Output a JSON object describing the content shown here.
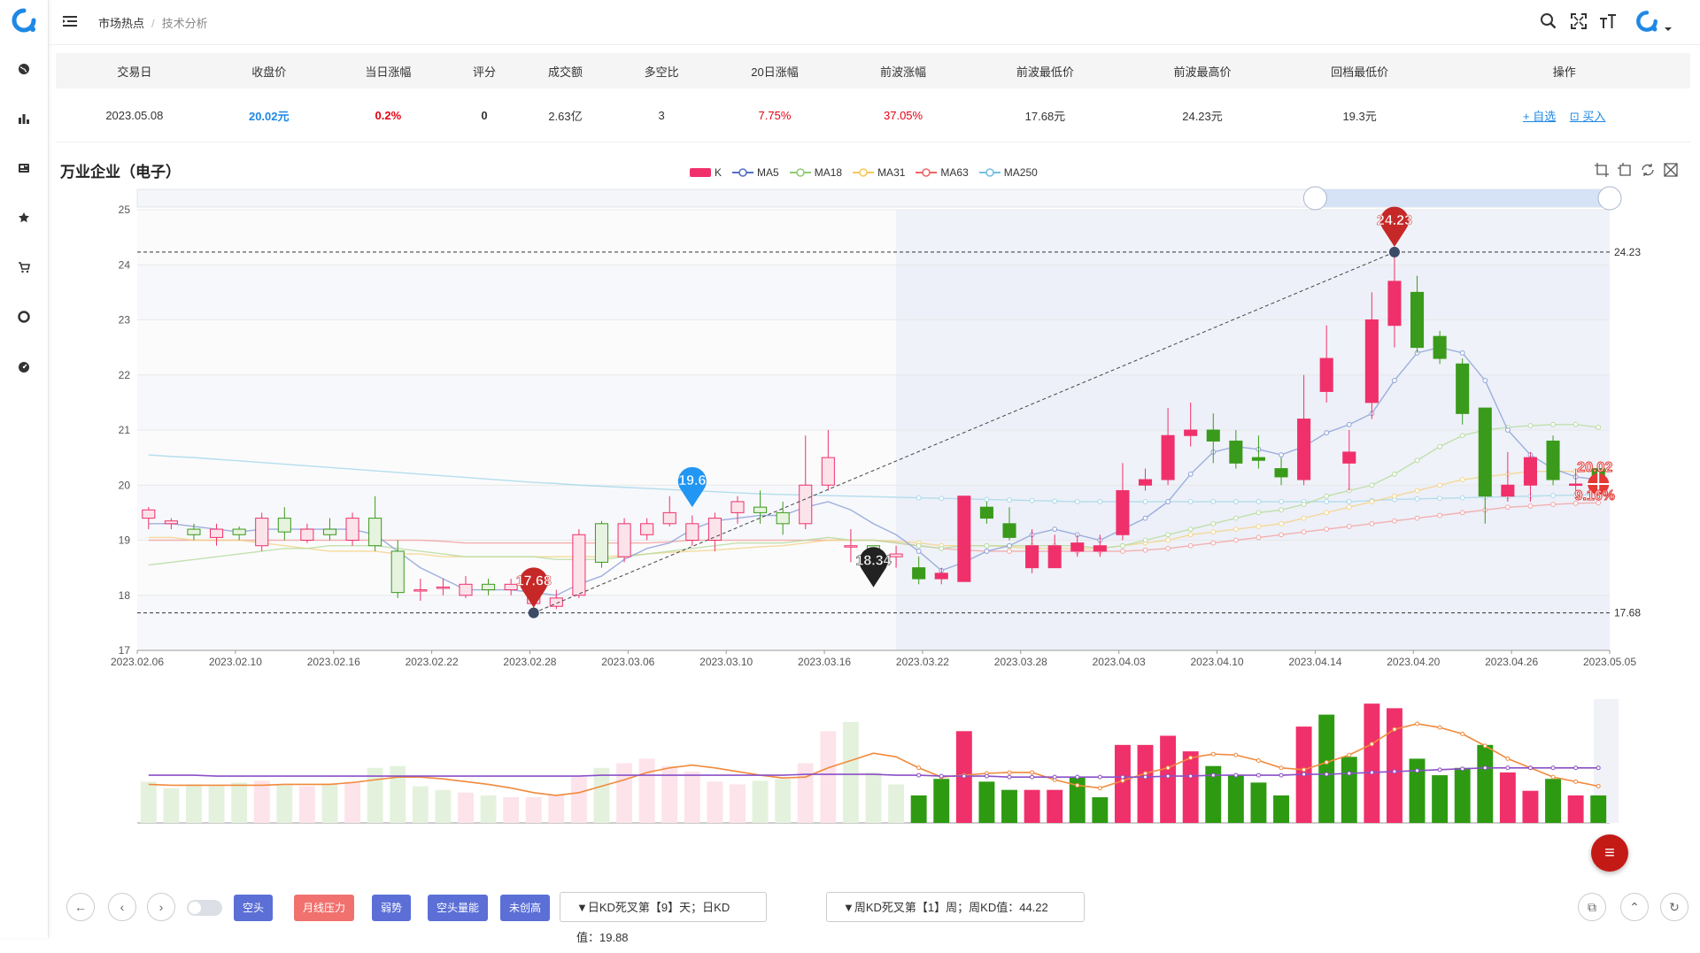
{
  "breadcrumb": {
    "root": "市场热点",
    "current": "技术分析"
  },
  "summary": {
    "headers": [
      "交易日",
      "收盘价",
      "当日涨幅",
      "评分",
      "成交额",
      "多空比",
      "20日涨幅",
      "前波涨幅",
      "前波最低价",
      "前波最高价",
      "回档最低价",
      "操作"
    ],
    "row": {
      "date": "2023.05.08",
      "close": "20.02元",
      "change": "0.2%",
      "score": "0",
      "turnover": "2.63亿",
      "ratio": "3",
      "change20": "7.75%",
      "prev_wave": "37.05%",
      "prev_low": "17.68元",
      "prev_high": "24.23元",
      "pullback_low": "19.3元"
    },
    "ops": {
      "watch": "+ 自选",
      "buy": "买入"
    }
  },
  "chart_title": "万业企业（电子）",
  "legend": [
    {
      "name": "K",
      "color": "#f0306a"
    },
    {
      "name": "MA5",
      "color": "#5470c6"
    },
    {
      "name": "MA18",
      "color": "#91cc75"
    },
    {
      "name": "MA31",
      "color": "#fac858"
    },
    {
      "name": "MA63",
      "color": "#ee6666"
    },
    {
      "name": "MA250",
      "color": "#73c0de"
    }
  ],
  "bottom": {
    "tags": [
      {
        "label": "空头",
        "color": "#5b6fd6"
      },
      {
        "label": "月线压力",
        "color": "#f0716e"
      },
      {
        "label": "弱势",
        "color": "#5b6fd6"
      },
      {
        "label": "空头量能",
        "color": "#5b6fd6"
      },
      {
        "label": "未创高",
        "color": "#5b6fd6"
      }
    ],
    "kd_day": "▼日KD死叉第【9】天；日KD值：19.88",
    "kd_week": "▼周KD死叉第【1】周；周KD值：44.22"
  },
  "colors": {
    "up": "#f0306a",
    "down": "#3a9a1b",
    "accent": "#1e88e5"
  },
  "chart_data": {
    "type": "candlestick",
    "ylim": [
      17,
      25
    ],
    "yticks": [
      "25",
      "24",
      "23",
      "22",
      "21",
      "20",
      "19",
      "18",
      "17"
    ],
    "xticks": [
      "2023.02.06",
      "2023.02.10",
      "2023.02.16",
      "2023.02.22",
      "2023.02.28",
      "2023.03.06",
      "2023.03.10",
      "2023.03.16",
      "2023.03.22",
      "2023.03.28",
      "2023.04.03",
      "2023.04.10",
      "2023.04.14",
      "2023.04.20",
      "2023.04.26",
      "2023.05.05"
    ],
    "candles": [
      [
        19.4,
        19.55,
        19.2,
        19.6
      ],
      [
        19.3,
        19.35,
        19.2,
        19.4
      ],
      [
        19.2,
        19.1,
        19.0,
        19.3
      ],
      [
        19.05,
        19.2,
        18.9,
        19.3
      ],
      [
        19.2,
        19.1,
        19.0,
        19.25
      ],
      [
        18.9,
        19.4,
        18.8,
        19.5
      ],
      [
        19.4,
        19.15,
        19.0,
        19.6
      ],
      [
        19.0,
        19.2,
        18.95,
        19.3
      ],
      [
        19.2,
        19.1,
        19.0,
        19.4
      ],
      [
        19.0,
        19.4,
        18.9,
        19.5
      ],
      [
        19.4,
        18.9,
        18.8,
        19.8
      ],
      [
        18.8,
        18.05,
        17.95,
        19.0
      ],
      [
        18.1,
        18.1,
        17.9,
        18.3
      ],
      [
        18.15,
        18.15,
        18.0,
        18.3
      ],
      [
        18.0,
        18.2,
        17.95,
        18.35
      ],
      [
        18.2,
        18.1,
        18.0,
        18.3
      ],
      [
        18.1,
        18.2,
        18.0,
        18.3
      ],
      [
        17.85,
        18.05,
        17.7,
        18.3
      ],
      [
        17.8,
        17.95,
        17.75,
        18.1
      ],
      [
        18.0,
        19.1,
        17.95,
        19.2
      ],
      [
        19.3,
        18.6,
        18.5,
        19.35
      ],
      [
        18.7,
        19.3,
        18.6,
        19.4
      ],
      [
        19.1,
        19.3,
        19.0,
        19.4
      ],
      [
        19.3,
        19.5,
        19.25,
        19.8
      ],
      [
        19.0,
        19.3,
        18.9,
        19.45
      ],
      [
        19.0,
        19.4,
        18.8,
        19.5
      ],
      [
        19.5,
        19.7,
        19.3,
        19.8
      ],
      [
        19.6,
        19.5,
        19.3,
        19.9
      ],
      [
        19.5,
        19.3,
        19.1,
        19.7
      ],
      [
        19.3,
        20.0,
        19.2,
        20.9
      ],
      [
        20.0,
        20.5,
        19.9,
        21.0
      ],
      [
        18.9,
        18.9,
        18.6,
        19.2
      ],
      [
        18.9,
        18.7,
        18.3,
        18.9
      ],
      [
        18.7,
        18.75,
        18.5,
        18.9
      ],
      [
        18.5,
        18.3,
        18.2,
        18.7
      ],
      [
        18.3,
        18.4,
        18.2,
        18.5
      ],
      [
        18.25,
        19.8,
        18.25,
        19.8
      ],
      [
        19.6,
        19.4,
        19.3,
        19.7
      ],
      [
        19.3,
        19.05,
        19.0,
        19.6
      ],
      [
        18.5,
        18.9,
        18.4,
        19.2
      ],
      [
        18.5,
        18.9,
        18.5,
        19.1
      ],
      [
        18.8,
        18.95,
        18.7,
        19.1
      ],
      [
        18.8,
        18.9,
        18.7,
        19.1
      ],
      [
        19.1,
        19.9,
        19.0,
        20.4
      ],
      [
        20.0,
        20.1,
        19.9,
        20.3
      ],
      [
        20.1,
        20.9,
        20.0,
        21.4
      ],
      [
        20.9,
        21.0,
        20.7,
        21.5
      ],
      [
        21.0,
        20.8,
        20.4,
        21.3
      ],
      [
        20.8,
        20.4,
        20.3,
        21.0
      ],
      [
        20.5,
        20.45,
        20.3,
        20.9
      ],
      [
        20.3,
        20.15,
        20.0,
        20.5
      ],
      [
        20.1,
        21.2,
        20.0,
        22.0
      ],
      [
        21.7,
        22.3,
        21.5,
        22.9
      ],
      [
        20.4,
        20.6,
        19.9,
        21.0
      ],
      [
        21.5,
        23.0,
        21.2,
        23.5
      ],
      [
        22.9,
        23.7,
        22.5,
        24.23
      ],
      [
        23.5,
        22.5,
        22.4,
        23.8
      ],
      [
        22.7,
        22.3,
        22.2,
        22.8
      ],
      [
        22.2,
        21.3,
        21.1,
        22.3
      ],
      [
        21.4,
        19.8,
        19.3,
        21.4
      ],
      [
        19.8,
        20.0,
        19.7,
        20.6
      ],
      [
        20.0,
        20.5,
        19.7,
        20.6
      ],
      [
        20.8,
        20.1,
        20.0,
        20.9
      ],
      [
        20.0,
        20.02,
        19.9,
        20.3
      ],
      [
        20.3,
        19.95,
        19.8,
        20.4
      ]
    ],
    "ma5": [
      19.3,
      19.3,
      19.25,
      19.2,
      19.15,
      19.2,
      19.2,
      19.2,
      19.2,
      19.2,
      19.1,
      18.8,
      18.5,
      18.3,
      18.1,
      18.1,
      18.1,
      18.05,
      18.0,
      18.2,
      18.35,
      18.65,
      18.85,
      18.95,
      19.2,
      19.35,
      19.4,
      19.45,
      19.45,
      19.6,
      19.7,
      19.55,
      19.3,
      19.1,
      18.8,
      18.45,
      18.6,
      18.8,
      18.9,
      19.1,
      19.2,
      19.1,
      19.0,
      19.2,
      19.4,
      19.7,
      20.2,
      20.6,
      20.7,
      20.65,
      20.55,
      20.7,
      20.95,
      21.1,
      21.3,
      21.9,
      22.4,
      22.5,
      22.4,
      21.9,
      21.0,
      20.55,
      20.3,
      20.15,
      20.1
    ],
    "ma18": [
      18.55,
      18.6,
      18.65,
      18.7,
      18.75,
      18.8,
      18.85,
      18.85,
      18.9,
      18.9,
      18.9,
      18.85,
      18.8,
      18.75,
      18.7,
      18.7,
      18.7,
      18.7,
      18.65,
      18.65,
      18.65,
      18.7,
      18.75,
      18.8,
      18.85,
      18.9,
      18.95,
      18.95,
      18.95,
      19.0,
      19.05,
      19.0,
      19.0,
      18.95,
      18.9,
      18.85,
      18.9,
      18.9,
      18.9,
      18.9,
      18.9,
      18.9,
      18.85,
      18.9,
      19.0,
      19.1,
      19.2,
      19.3,
      19.4,
      19.5,
      19.55,
      19.65,
      19.8,
      19.9,
      20.0,
      20.2,
      20.45,
      20.7,
      20.9,
      21.0,
      21.05,
      21.08,
      21.1,
      21.1,
      21.05
    ],
    "ma31": [
      19.05,
      19.05,
      19.0,
      19.0,
      19.0,
      18.95,
      18.9,
      18.85,
      18.8,
      18.8,
      18.8,
      18.75,
      18.75,
      18.7,
      18.7,
      18.7,
      18.7,
      18.7,
      18.7,
      18.7,
      18.7,
      18.72,
      18.75,
      18.78,
      18.8,
      18.82,
      18.85,
      18.88,
      18.9,
      18.95,
      19.0,
      19.0,
      19.0,
      18.98,
      18.95,
      18.9,
      18.9,
      18.9,
      18.88,
      18.85,
      18.85,
      18.85,
      18.85,
      18.9,
      18.95,
      19.0,
      19.1,
      19.15,
      19.2,
      19.25,
      19.3,
      19.4,
      19.5,
      19.6,
      19.7,
      19.8,
      19.9,
      20.0,
      20.1,
      20.15,
      20.2,
      20.25,
      20.25,
      20.25,
      20.25
    ],
    "ma63": [
      19.0,
      19.0,
      19.0,
      19.0,
      19.0,
      19.0,
      19.0,
      19.0,
      19.0,
      19.0,
      19.0,
      19.0,
      19.0,
      18.98,
      18.95,
      18.95,
      18.95,
      18.95,
      18.95,
      18.95,
      18.95,
      18.95,
      18.95,
      18.97,
      19.0,
      19.0,
      19.0,
      19.0,
      19.0,
      19.0,
      19.0,
      19.0,
      19.0,
      18.95,
      18.9,
      18.85,
      18.82,
      18.8,
      18.8,
      18.8,
      18.8,
      18.8,
      18.8,
      18.8,
      18.82,
      18.85,
      18.9,
      18.95,
      19.0,
      19.05,
      19.1,
      19.15,
      19.2,
      19.25,
      19.3,
      19.35,
      19.4,
      19.45,
      19.5,
      19.55,
      19.6,
      19.62,
      19.65,
      19.67,
      19.68
    ],
    "ma250": [
      20.55,
      20.52,
      20.5,
      20.47,
      20.44,
      20.41,
      20.38,
      20.35,
      20.32,
      20.29,
      20.26,
      20.23,
      20.2,
      20.17,
      20.14,
      20.11,
      20.08,
      20.05,
      20.03,
      20.0,
      19.98,
      19.96,
      19.94,
      19.92,
      19.9,
      19.88,
      19.86,
      19.84,
      19.83,
      19.82,
      19.81,
      19.8,
      19.79,
      19.78,
      19.77,
      19.76,
      19.75,
      19.74,
      19.73,
      19.72,
      19.71,
      19.7,
      19.7,
      19.7,
      19.7,
      19.7,
      19.7,
      19.7,
      19.7,
      19.7,
      19.7,
      19.7,
      19.7,
      19.7,
      19.72,
      19.74,
      19.75,
      19.76,
      19.77,
      19.78,
      19.79,
      19.8,
      19.81,
      19.82,
      19.83
    ],
    "volumes": [
      0.45,
      0.38,
      0.42,
      0.4,
      0.44,
      0.46,
      0.41,
      0.4,
      0.43,
      0.45,
      0.6,
      0.62,
      0.4,
      0.36,
      0.33,
      0.3,
      0.28,
      0.28,
      0.31,
      0.5,
      0.6,
      0.65,
      0.7,
      0.62,
      0.56,
      0.45,
      0.42,
      0.46,
      0.48,
      0.65,
      1.0,
      1.1,
      0.93,
      0.7,
      0.58,
      0.5,
      0.58,
      0.66,
      0.64,
      0.56,
      0.46,
      0.44,
      0.46,
      0.51,
      0.6,
      0.64,
      0.66,
      0.62,
      0.65,
      0.6,
      0.55,
      0.5,
      0.58,
      0.61,
      0.63,
      0.66,
      0.63,
      0.62,
      0.6,
      0.58,
      0.54,
      0.5,
      0.46,
      0.43,
      0.4
    ],
    "vol_colors": [
      "d",
      "d",
      "d",
      "d",
      "d",
      "u",
      "d",
      "u",
      "d",
      "u",
      "d",
      "d",
      "d",
      "d",
      "u",
      "d",
      "u",
      "u",
      "u",
      "u",
      "d",
      "u",
      "u",
      "u",
      "u",
      "u",
      "u",
      "d",
      "d",
      "u",
      "u",
      "d",
      "d",
      "d",
      "d",
      "d",
      "u",
      "d",
      "d",
      "u",
      "u",
      "d",
      "d",
      "u",
      "u",
      "u",
      "u",
      "d",
      "d",
      "d",
      "d",
      "u",
      "d",
      "d",
      "u",
      "u",
      "d",
      "d",
      "d",
      "d",
      "u",
      "u",
      "d",
      "u",
      "d"
    ],
    "vol_values": [
      0.45,
      0.38,
      0.42,
      0.4,
      0.44,
      0.46,
      0.41,
      0.4,
      0.43,
      0.45,
      0.6,
      0.62,
      0.4,
      0.36,
      0.33,
      0.3,
      0.28,
      0.28,
      0.31,
      0.5,
      0.6,
      0.65,
      0.7,
      0.62,
      0.56,
      0.45,
      0.42,
      0.46,
      0.48,
      0.65,
      1.0,
      1.1,
      0.55,
      0.42,
      0.3,
      0.48,
      1.0,
      0.45,
      0.36,
      0.36,
      0.36,
      0.5,
      0.28,
      0.85,
      0.85,
      0.95,
      0.78,
      0.62,
      0.52,
      0.44,
      0.3,
      1.05,
      1.18,
      0.72,
      1.3,
      1.25,
      0.7,
      0.52,
      0.6,
      0.85,
      0.55,
      0.35,
      0.48,
      0.3,
      0.3
    ],
    "vol_ma": [
      0.42,
      0.41,
      0.41,
      0.41,
      0.41,
      0.41,
      0.42,
      0.42,
      0.42,
      0.44,
      0.47,
      0.5,
      0.5,
      0.48,
      0.45,
      0.42,
      0.38,
      0.33,
      0.3,
      0.33,
      0.4,
      0.47,
      0.55,
      0.6,
      0.63,
      0.6,
      0.56,
      0.52,
      0.49,
      0.5,
      0.6,
      0.68,
      0.76,
      0.72,
      0.6,
      0.5,
      0.52,
      0.54,
      0.55,
      0.55,
      0.47,
      0.41,
      0.38,
      0.46,
      0.54,
      0.6,
      0.71,
      0.75,
      0.74,
      0.68,
      0.6,
      0.58,
      0.66,
      0.74,
      0.86,
      1.02,
      1.08,
      1.04,
      0.97,
      0.84,
      0.7,
      0.6,
      0.5,
      0.45,
      0.4
    ],
    "vol_ma2": [
      0.52,
      0.52,
      0.52,
      0.51,
      0.51,
      0.51,
      0.51,
      0.51,
      0.51,
      0.51,
      0.51,
      0.51,
      0.51,
      0.51,
      0.51,
      0.51,
      0.51,
      0.51,
      0.51,
      0.51,
      0.52,
      0.52,
      0.52,
      0.52,
      0.52,
      0.52,
      0.52,
      0.52,
      0.52,
      0.53,
      0.53,
      0.53,
      0.53,
      0.52,
      0.52,
      0.51,
      0.51,
      0.51,
      0.5,
      0.5,
      0.5,
      0.5,
      0.5,
      0.5,
      0.5,
      0.51,
      0.51,
      0.52,
      0.52,
      0.52,
      0.52,
      0.53,
      0.53,
      0.54,
      0.55,
      0.56,
      0.57,
      0.58,
      0.59,
      0.6,
      0.6,
      0.6,
      0.6,
      0.6,
      0.6
    ],
    "markers": [
      {
        "label": "24.23",
        "value": 24.23,
        "kind": "high"
      },
      {
        "label": "17.68",
        "value": 17.68,
        "kind": "low"
      },
      {
        "label": "19.6",
        "value": 19.6,
        "kind": "blue"
      },
      {
        "label": "18.34",
        "value": 18.34,
        "kind": "black"
      },
      {
        "label": "20.02",
        "value": 20.02,
        "kind": "last"
      },
      {
        "label": "9.16%",
        "kind": "pct"
      }
    ],
    "ref_lines": [
      {
        "label": "24.23",
        "value": 24.23
      },
      {
        "label": "17.68",
        "value": 17.68
      }
    ]
  }
}
